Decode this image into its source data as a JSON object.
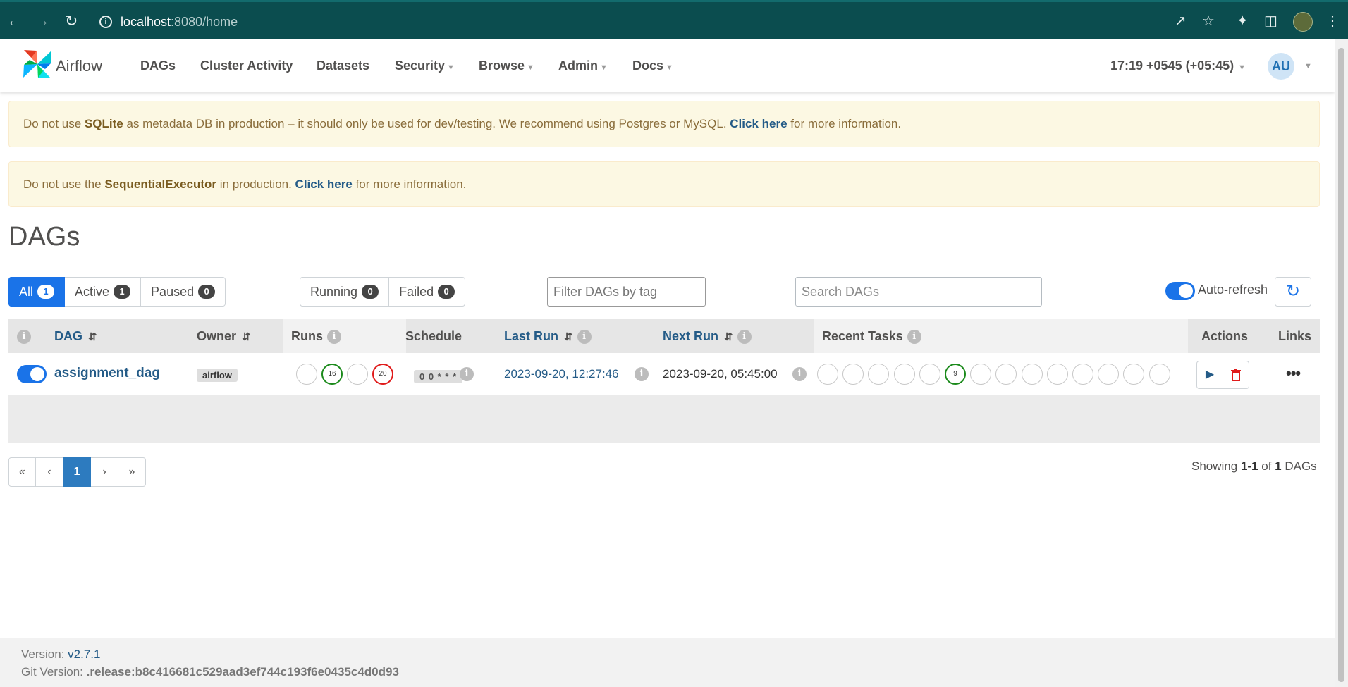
{
  "browser": {
    "url_host": "localhost",
    "url_port_path": ":8080/home",
    "icons": [
      "back-arrow-icon",
      "forward-arrow-icon",
      "reload-icon",
      "info-icon",
      "share-icon",
      "star-icon",
      "extensions-icon",
      "sidepanel-icon",
      "profile-icon",
      "menu-icon"
    ]
  },
  "nav": {
    "logo_text": "Airflow",
    "items": [
      {
        "label": "DAGs",
        "dropdown": false
      },
      {
        "label": "Cluster Activity",
        "dropdown": false
      },
      {
        "label": "Datasets",
        "dropdown": false
      },
      {
        "label": "Security",
        "dropdown": true
      },
      {
        "label": "Browse",
        "dropdown": true
      },
      {
        "label": "Admin",
        "dropdown": true
      },
      {
        "label": "Docs",
        "dropdown": true
      }
    ],
    "time": "17:19 +0545 (+05:45)",
    "user_initials": "AU"
  },
  "alerts": [
    {
      "pre": "Do not use ",
      "bold": "SQLite",
      "mid": " as metadata DB in production – it should only be used for dev/testing. We recommend using Postgres or MySQL. ",
      "link": "Click here",
      "post": " for more information."
    },
    {
      "pre": "Do not use the ",
      "bold": "SequentialExecutor",
      "mid": " in production. ",
      "link": "Click here",
      "post": " for more information."
    }
  ],
  "page_title": "DAGs",
  "status_filters": [
    {
      "label": "All",
      "count": "1",
      "active": true
    },
    {
      "label": "Active",
      "count": "1",
      "active": false
    },
    {
      "label": "Paused",
      "count": "0",
      "active": false
    }
  ],
  "run_filters": [
    {
      "label": "Running",
      "count": "0"
    },
    {
      "label": "Failed",
      "count": "0"
    }
  ],
  "tag_filter_placeholder": "Filter DAGs by tag",
  "search_placeholder": "Search DAGs",
  "auto_refresh_label": "Auto-refresh",
  "table": {
    "headers": {
      "dag": "DAG",
      "owner": "Owner",
      "runs": "Runs",
      "schedule": "Schedule",
      "last_run": "Last Run",
      "next_run": "Next Run",
      "recent_tasks": "Recent Tasks",
      "actions": "Actions",
      "links": "Links"
    },
    "rows": [
      {
        "dag_id": "assignment_dag",
        "owner": "airflow",
        "runs": [
          {
            "count": "",
            "state": "none"
          },
          {
            "count": "16",
            "state": "success"
          },
          {
            "count": "",
            "state": "none"
          },
          {
            "count": "20",
            "state": "failed"
          }
        ],
        "schedule": "0 0 * * *",
        "last_run": "2023-09-20, 12:27:46",
        "next_run": "2023-09-20, 05:45:00",
        "recent_tasks_count": 14,
        "recent_tasks_labeled_index": 5,
        "recent_tasks_labeled_value": "9",
        "links_glyph": "•••"
      }
    ]
  },
  "pagination": {
    "first": "«",
    "prev": "‹",
    "current": "1",
    "next": "›",
    "last": "»"
  },
  "showing": {
    "pre": "Showing ",
    "range": "1-1",
    "mid": " of ",
    "total": "1",
    "post": " DAGs"
  },
  "footer": {
    "version_label": "Version: ",
    "version": "v2.7.1",
    "git_label": "Git Version: ",
    "git": ".release:b8c416681c529aad3ef744c193f6e0435c4d0d93"
  },
  "colors": {
    "primary": "#1a73e8",
    "link": "#245b87",
    "success": "#1b8a1b",
    "failed": "#e01b1b",
    "alert_bg": "#fcf8e3",
    "chrome": "#0b4d4f"
  }
}
